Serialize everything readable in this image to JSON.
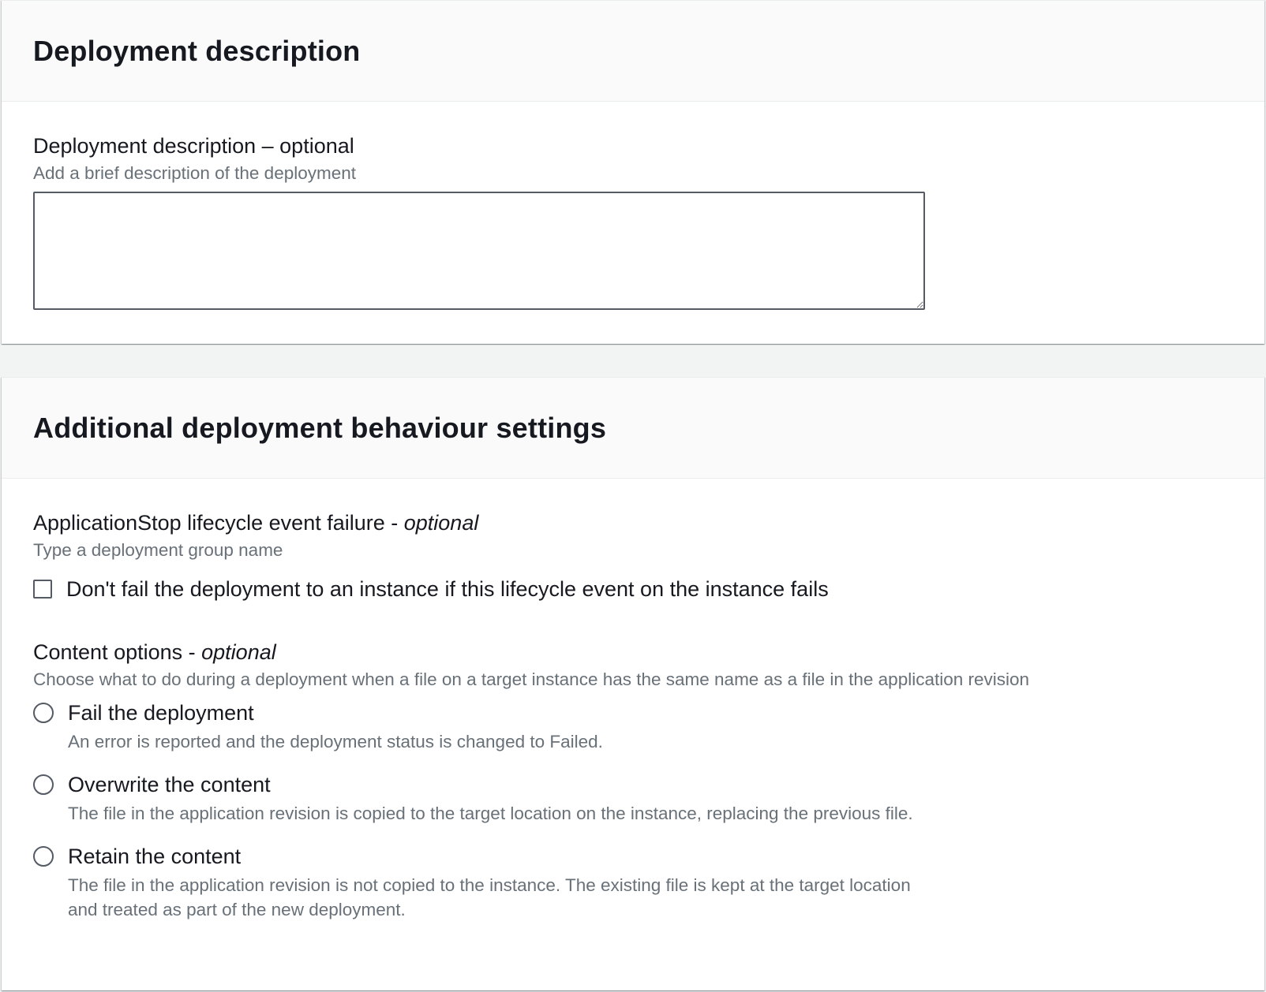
{
  "deployment_description": {
    "title": "Deployment description",
    "field_label": "Deployment description – optional",
    "field_desc": "Add a brief description of the deployment",
    "value": ""
  },
  "additional_settings": {
    "title": "Additional deployment behaviour settings",
    "application_stop": {
      "label": "ApplicationStop lifecycle event failure - ",
      "optional": "optional",
      "desc": "Type a deployment group name",
      "checkbox_label": "Don't fail the deployment to an instance if this lifecycle event on the instance fails",
      "checked": false
    },
    "content_options": {
      "label": "Content options - ",
      "optional": "optional",
      "desc": "Choose what to do during a deployment when a file on a target instance has the same name as a file in the application revision",
      "options": [
        {
          "title": "Fail the deployment",
          "desc": "An error is reported and the deployment status is changed to Failed.",
          "selected": false
        },
        {
          "title": "Overwrite the content",
          "desc": "The file in the application revision is copied to the target location on the instance, replacing the previous file.",
          "selected": false
        },
        {
          "title": "Retain the content",
          "desc": "The file in the application revision is not copied to the instance. The existing file is kept at the target location and treated as part of the new deployment.",
          "selected": false
        }
      ]
    }
  }
}
